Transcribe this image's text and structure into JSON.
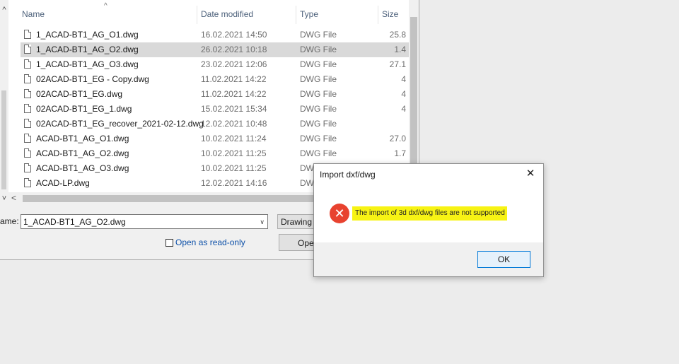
{
  "file_list": {
    "columns": {
      "name": "Name",
      "date": "Date modified",
      "type": "Type",
      "size": "Size"
    },
    "files": [
      {
        "name": "1_ACAD-BT1_AG_O1.dwg",
        "date": "16.02.2021 14:50",
        "type": "DWG File",
        "size": "25.8"
      },
      {
        "name": "1_ACAD-BT1_AG_O2.dwg",
        "date": "26.02.2021 10:18",
        "type": "DWG File",
        "size": "1.4",
        "selected": true
      },
      {
        "name": "1_ACAD-BT1_AG_O3.dwg",
        "date": "23.02.2021 12:06",
        "type": "DWG File",
        "size": "27.1"
      },
      {
        "name": "02ACAD-BT1_EG - Copy.dwg",
        "date": "11.02.2021 14:22",
        "type": "DWG File",
        "size": "4"
      },
      {
        "name": "02ACAD-BT1_EG.dwg",
        "date": "11.02.2021 14:22",
        "type": "DWG File",
        "size": "4"
      },
      {
        "name": "02ACAD-BT1_EG_1.dwg",
        "date": "15.02.2021 15:34",
        "type": "DWG File",
        "size": "4"
      },
      {
        "name": "02ACAD-BT1_EG_recover_2021-02-12.dwg",
        "date": "12.02.2021 10:48",
        "type": "DWG File",
        "size": ""
      },
      {
        "name": "ACAD-BT1_AG_O1.dwg",
        "date": "10.02.2021 11:24",
        "type": "DWG File",
        "size": "27.0"
      },
      {
        "name": "ACAD-BT1_AG_O2.dwg",
        "date": "10.02.2021 11:25",
        "type": "DWG File",
        "size": "1.7"
      },
      {
        "name": "ACAD-BT1_AG_O3.dwg",
        "date": "10.02.2021 11:25",
        "type": "DW",
        "size": ""
      },
      {
        "name": "ACAD-LP.dwg",
        "date": "12.02.2021 14:16",
        "type": "DW",
        "size": ""
      }
    ]
  },
  "file_name_label": "ame:",
  "file_name_value": "1_ACAD-BT1_AG_O2.dwg",
  "file_type_value": "Drawing",
  "read_only_label": "Open as read-only",
  "open_button_label": "Ope",
  "icons": {
    "sort": "chevron-up-icon",
    "close": "close-icon",
    "error": "error-icon",
    "file": "document-icon"
  },
  "alert": {
    "title": "Import dxf/dwg",
    "message": "The import of 3d dxf/dwg files are not supported",
    "ok_label": "OK",
    "colors": {
      "error_icon": "#e8422f",
      "highlight": "#f7f314",
      "ok_border": "#0078d7"
    }
  }
}
